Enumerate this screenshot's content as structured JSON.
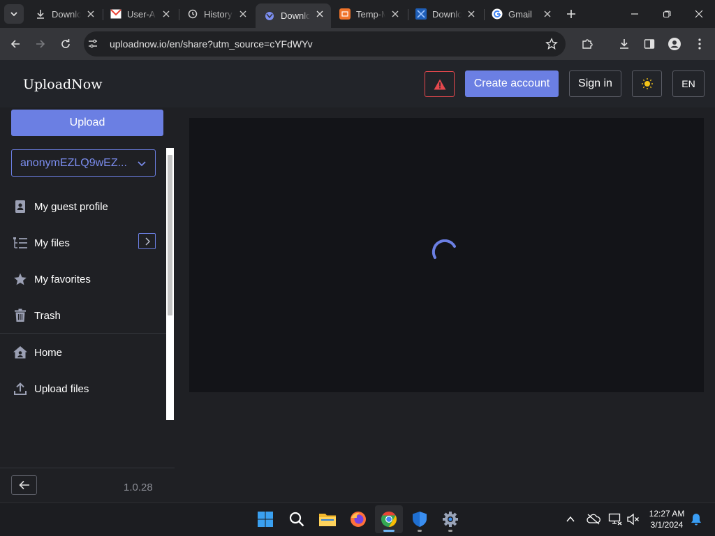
{
  "browser": {
    "tabs": [
      {
        "title": "Downlo",
        "icon": "download-icon"
      },
      {
        "title": "User-A",
        "icon": "gmail-favicon"
      },
      {
        "title": "History",
        "icon": "history-icon"
      },
      {
        "title": "Downlo",
        "icon": "uploadnow-favicon",
        "active": true
      },
      {
        "title": "Temp-M",
        "icon": "temp-mail-favicon"
      },
      {
        "title": "Downlo",
        "icon": "x-favicon"
      },
      {
        "title": "Gmail",
        "icon": "google-favicon"
      }
    ],
    "url": "uploadnow.io/en/share?utm_source=cYFdWYv"
  },
  "header": {
    "logo": "UploadNow",
    "create_account": "Create account",
    "sign_in": "Sign in",
    "language": "EN"
  },
  "sidebar": {
    "upload_label": "Upload",
    "account": "anonymEZLQ9wEZ...",
    "items": [
      {
        "label": "My guest profile",
        "icon": "profile-icon"
      },
      {
        "label": "My files",
        "icon": "files-tree-icon"
      },
      {
        "label": "My favorites",
        "icon": "star-icon"
      },
      {
        "label": "Trash",
        "icon": "trash-icon"
      },
      {
        "label": "Home",
        "icon": "home-icon"
      },
      {
        "label": "Upload files",
        "icon": "upload-icon"
      }
    ],
    "version": "1.0.28"
  },
  "taskbar": {
    "time": "12:27 AM",
    "date": "3/1/2024"
  },
  "colors": {
    "accent": "#6b7fe3",
    "alert": "#e5484d",
    "background": "#1f2024"
  }
}
